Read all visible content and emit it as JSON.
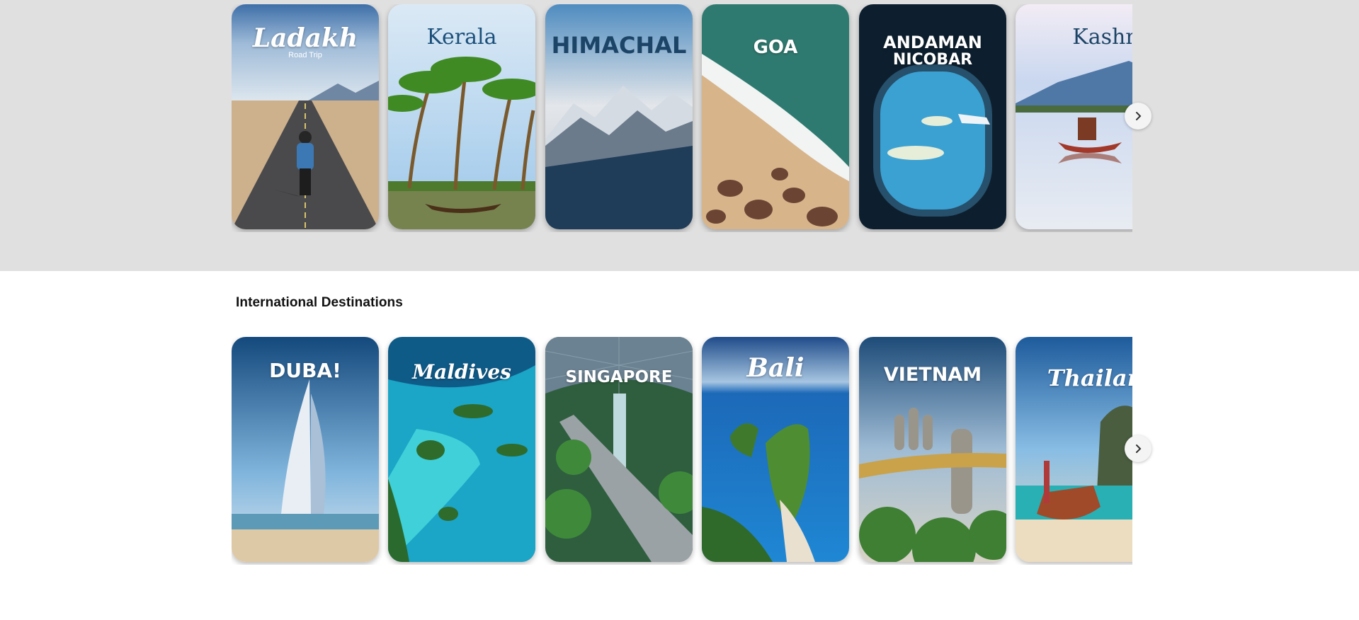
{
  "domestic": {
    "cards": [
      {
        "label": "Ladakh",
        "sub": "Road Trip",
        "icon": "road-trip-scene"
      },
      {
        "label": "Kerala",
        "icon": "palm-tree-icon"
      },
      {
        "label": "HIMACHAL",
        "icon": "mountain-icon"
      },
      {
        "label": "GOA",
        "icon": "wave-icon"
      },
      {
        "label": "ANDAMAN",
        "label2": "NICOBAR",
        "icon": "airplane-window-scene"
      },
      {
        "label": "Kashmir",
        "icon": "shikara-boat-scene"
      }
    ],
    "next_icon": "chevron-right-icon"
  },
  "international": {
    "title": "International Destinations",
    "cards": [
      {
        "label": "DUBA!",
        "icon": "burj-al-arab-scene"
      },
      {
        "label": "Maldives",
        "icon": "island-scene"
      },
      {
        "label": "SINGAPORE",
        "icon": "jewel-waterfall-scene"
      },
      {
        "label": "Bali",
        "icon": "cliff-coast-scene"
      },
      {
        "label": "VIETNAM",
        "icon": "golden-bridge-scene"
      },
      {
        "label": "Thailand",
        "icon": "longtail-boat-scene"
      }
    ],
    "next_icon": "chevron-right-icon"
  },
  "colors": {
    "top_band": "#e0e0e0",
    "card_text": "#ffffff",
    "title_text": "#111111"
  }
}
